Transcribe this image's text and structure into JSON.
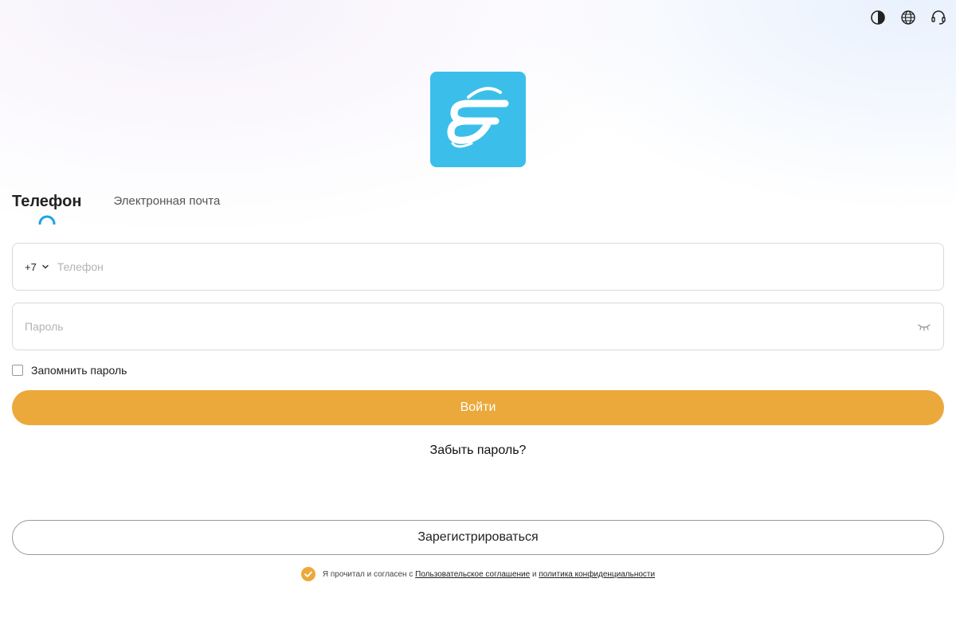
{
  "header": {
    "icons": [
      "contrast-icon",
      "globe-icon",
      "headset-icon"
    ]
  },
  "logo": {
    "color": "#3bbfea"
  },
  "tabs": {
    "phone": "Телефон",
    "email": "Электронная почта",
    "indicator_color": "#1aa3e8"
  },
  "phone_field": {
    "country_code": "+7",
    "placeholder": "Телефон",
    "value": ""
  },
  "password_field": {
    "placeholder": "Пароль",
    "value": ""
  },
  "remember": {
    "label": "Запомнить пароль",
    "checked": false
  },
  "login_button": {
    "label": "Войти",
    "color": "#eba93b"
  },
  "forgot_link": "Забыть пароль?",
  "register_button": {
    "label": "Зарегистрироваться"
  },
  "agreement": {
    "checked": true,
    "prefix": "Я прочитал и согласен с ",
    "terms_link": "Пользовательское соглашение",
    "conjunction": " и ",
    "privacy_link": "политика конфиденциальности"
  }
}
